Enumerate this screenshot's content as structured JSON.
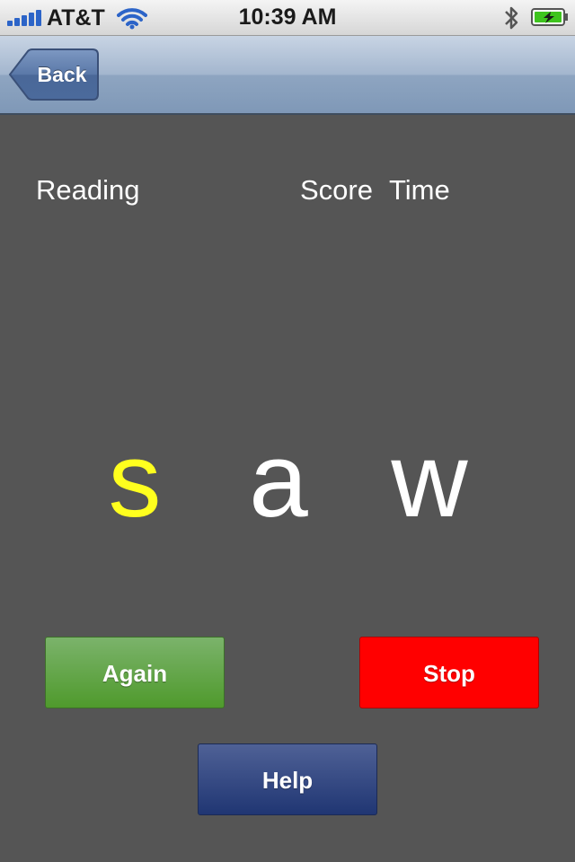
{
  "status_bar": {
    "carrier": "AT&T",
    "time": "10:39 AM",
    "signal_bars": 5,
    "icons": [
      "signal-icon",
      "wifi-icon",
      "bluetooth-icon",
      "battery-charging-icon"
    ]
  },
  "nav": {
    "back_label": "Back"
  },
  "headers": {
    "reading": "Reading",
    "score": "Score",
    "time": "Time"
  },
  "word": {
    "letters": [
      "s",
      "a",
      "w"
    ],
    "active_index": 0,
    "active_color": "#ffff1e",
    "inactive_color": "#ffffff"
  },
  "buttons": {
    "again": "Again",
    "stop": "Stop",
    "help": "Help"
  },
  "colors": {
    "background": "#555555",
    "again": "#5aa33c",
    "stop": "#ff0000",
    "help": "#2e4480"
  }
}
